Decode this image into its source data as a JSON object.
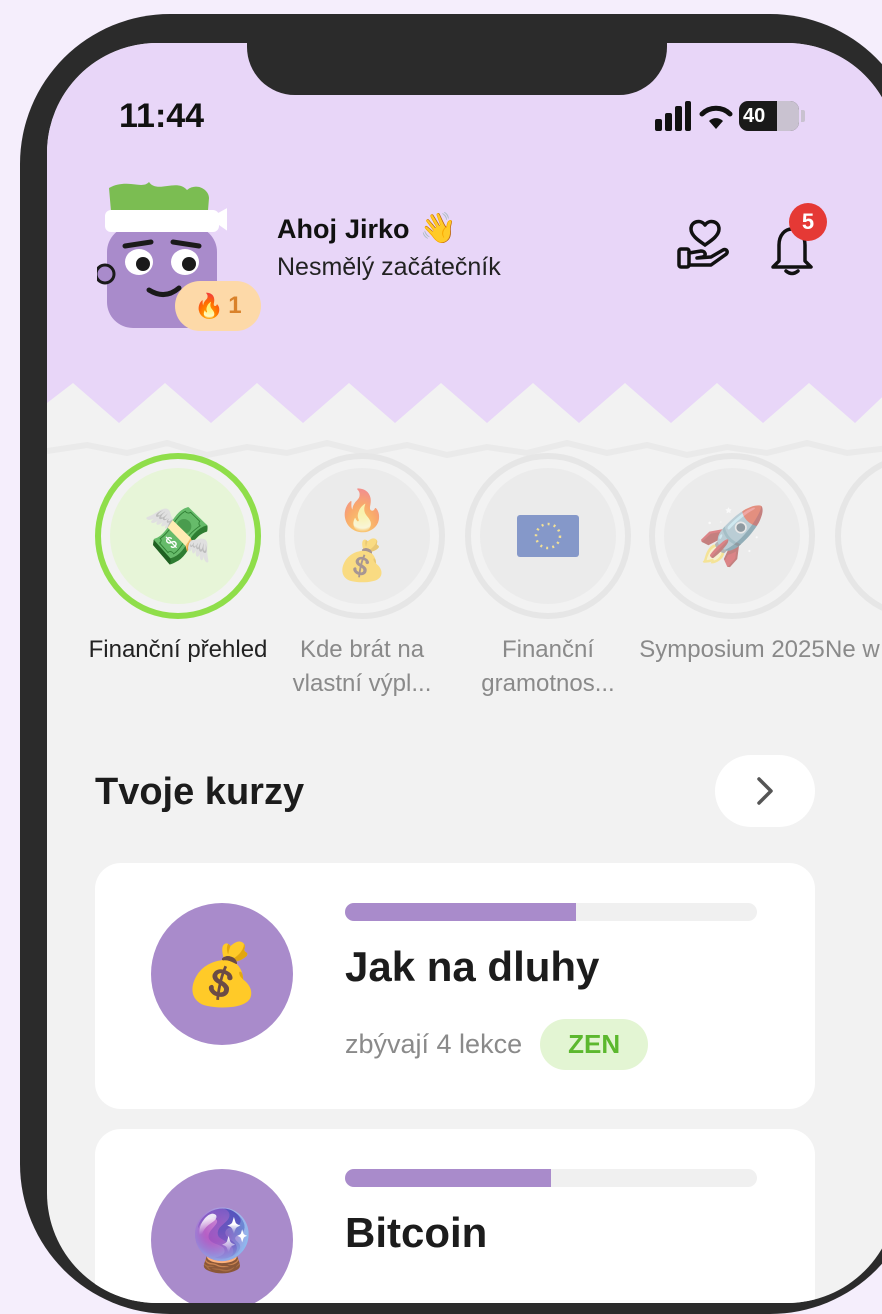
{
  "status_bar": {
    "time": "11:44",
    "battery": "40"
  },
  "header": {
    "greeting": "Ahoj",
    "user_name": "Jirko",
    "wave": "👋",
    "rank": "Nesmělý začátečník",
    "streak_count": "1",
    "streak_icon": "🔥",
    "notification_count": "5"
  },
  "stories": [
    {
      "label": "Finanční přehled",
      "icon": "💸",
      "active": true
    },
    {
      "label": "Kde brát na vlastní výpl...",
      "icon": "🔥💰",
      "active": false
    },
    {
      "label": "Finanční gramotnos...",
      "icon": "🇪🇺",
      "active": false
    },
    {
      "label": "Symposium 2025",
      "icon": "🚀",
      "active": false
    },
    {
      "label": "Ne w",
      "icon": "",
      "active": false
    }
  ],
  "courses_section": {
    "title": "Tvoje kurzy"
  },
  "courses": [
    {
      "title": "Jak na dluhy",
      "lessons": "zbývají 4 lekce",
      "tag": "ZEN",
      "icon": "💰",
      "progress": 0.56
    },
    {
      "title": "Bitcoin",
      "lessons": "",
      "tag": "",
      "icon": "🔮",
      "progress": 0.5
    }
  ],
  "colors": {
    "header_bg": "#e8d6f8",
    "accent_purple": "#a98bcb",
    "active_ring": "#8fde4a",
    "zen_tag_text": "#5cb82e",
    "badge_red": "#e53935"
  }
}
